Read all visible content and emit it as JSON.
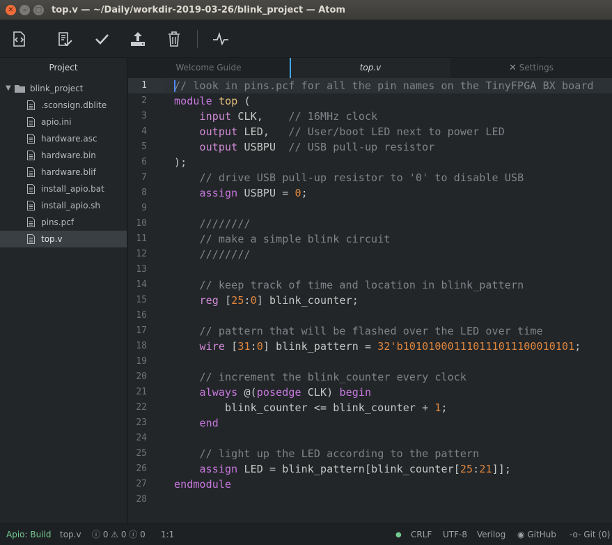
{
  "window": {
    "title": "top.v — ~/Daily/workdir-2019-03-26/blink_project — Atom"
  },
  "toolbar": {
    "icons": [
      "source-code-icon",
      "checklist-icon",
      "checkmark-icon",
      "upload-icon",
      "trash-icon",
      "pulse-icon"
    ]
  },
  "sidebar": {
    "title": "Project",
    "root": "blink_project",
    "files": [
      ".sconsign.dblite",
      "apio.ini",
      "hardware.asc",
      "hardware.bin",
      "hardware.blif",
      "install_apio.bat",
      "install_apio.sh",
      "pins.pcf",
      "top.v"
    ],
    "selected": "top.v"
  },
  "tabs": [
    {
      "label": "Welcome Guide",
      "active": false
    },
    {
      "label": "top.v",
      "active": true
    },
    {
      "label": "Settings",
      "active": false
    }
  ],
  "editor": {
    "current_line": 1,
    "lines": [
      "// look in pins.pcf for all the pin names on the TinyFPGA BX board",
      "module top (",
      "    input CLK,    // 16MHz clock",
      "    output LED,   // User/boot LED next to power LED",
      "    output USBPU  // USB pull-up resistor",
      ");",
      "    // drive USB pull-up resistor to '0' to disable USB",
      "    assign USBPU = 0;",
      "",
      "    ////////",
      "    // make a simple blink circuit",
      "    ////////",
      "",
      "    // keep track of time and location in blink_pattern",
      "    reg [25:0] blink_counter;",
      "",
      "    // pattern that will be flashed over the LED over time",
      "    wire [31:0] blink_pattern = 32'b101010001110111011100010101;",
      "",
      "    // increment the blink_counter every clock",
      "    always @(posedge CLK) begin",
      "        blink_counter <= blink_counter + 1;",
      "    end",
      "",
      "    // light up the LED according to the pattern",
      "    assign LED = blink_pattern[blink_counter[25:21]];",
      "endmodule",
      ""
    ]
  },
  "status": {
    "apio": "Apio: Build",
    "file": "top.v",
    "issues": "ⓘ 0 ⚠ 0 ⓘ 0",
    "position": "1:1",
    "line_ending": "CRLF",
    "encoding": "UTF-8",
    "grammar": "Verilog",
    "github": "GitHub",
    "git": "Git (0)"
  },
  "colors": {
    "accent": "#3fa9f5",
    "status_ok": "#73c990",
    "number": "#e0873e",
    "keyword": "#c678dd"
  }
}
